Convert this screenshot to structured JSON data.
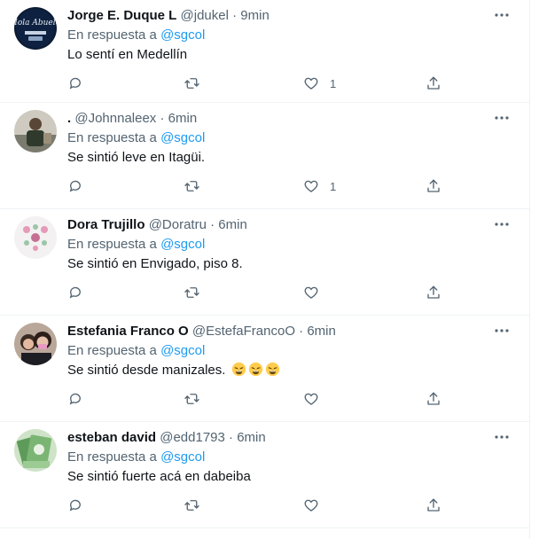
{
  "tweets": [
    {
      "name": "Jorge E. Duque L",
      "handle": "@jdukel",
      "separator": "·",
      "time": "9min",
      "reply_prefix": "En respuesta a",
      "reply_to": "@sgcol",
      "text": "Lo sentí en Medellín",
      "likes": "1",
      "avatar_text": "Hola Abuelo"
    },
    {
      "name": ".",
      "handle": "@Johnnaleex",
      "separator": "·",
      "time": "6min",
      "reply_prefix": "En respuesta a",
      "reply_to": "@sgcol",
      "text": "Se sintió leve en Itagüi.",
      "likes": "1"
    },
    {
      "name": "Dora Trujillo",
      "handle": "@Doratru",
      "separator": "·",
      "time": "6min",
      "reply_prefix": "En respuesta a",
      "reply_to": "@sgcol",
      "text": "Se sintió en Envigado, piso 8.",
      "likes": ""
    },
    {
      "name": "Estefania Franco O",
      "handle": "@EstefaFrancoO",
      "separator": "·",
      "time": "6min",
      "reply_prefix": "En respuesta a",
      "reply_to": "@sgcol",
      "text": "Se sintió desde manizales.",
      "likes": "",
      "emoji": [
        "weary-face",
        "weary-face",
        "weary-face"
      ]
    },
    {
      "name": "esteban david",
      "handle": "@edd1793",
      "separator": "·",
      "time": "6min",
      "reply_prefix": "En respuesta a",
      "reply_to": "@sgcol",
      "text": "Se sintió fuerte acá en dabeiba",
      "likes": ""
    }
  ],
  "colors": {
    "accent": "#1d9bf0",
    "secondary_text": "#536471",
    "primary_text": "#0f1419",
    "divider": "#eff3f4"
  },
  "icons": [
    "reply-icon",
    "retweet-icon",
    "like-icon",
    "share-icon",
    "more-icon"
  ]
}
